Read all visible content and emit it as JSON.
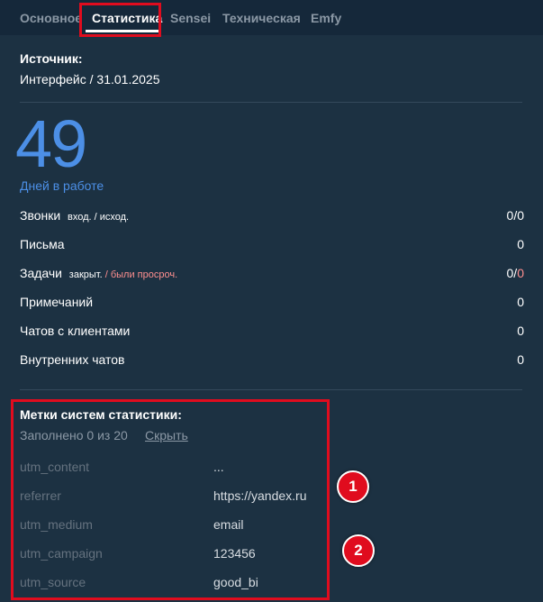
{
  "tabs": [
    {
      "label": "Основное"
    },
    {
      "label": "Статистика",
      "active": true
    },
    {
      "label": "Sensei"
    },
    {
      "label": "Техническая"
    },
    {
      "label": "Emfy"
    }
  ],
  "source": {
    "title": "Источник:",
    "value": "Интерфейс / 31.01.2025"
  },
  "days": {
    "number": "49",
    "label": "Дней в работе"
  },
  "stats": {
    "calls": {
      "label": "Звонки",
      "sub": "вход. / исход.",
      "value": "0/0"
    },
    "letters": {
      "label": "Письма",
      "value": "0"
    },
    "tasks": {
      "label": "Задачи",
      "sub_a": "закрыт.",
      "sub_sep": " / ",
      "sub_b": "были просроч.",
      "value_a": "0/",
      "value_b": "0"
    },
    "notes": {
      "label": "Примечаний",
      "value": "0"
    },
    "client_chats": {
      "label": "Чатов с клиентами",
      "value": "0"
    },
    "internal_chats": {
      "label": "Внутренних чатов",
      "value": "0"
    }
  },
  "utm": {
    "title": "Метки систем статистики:",
    "filled": "Заполнено 0 из 20",
    "hide_label": "Скрыть",
    "rows": [
      {
        "key": "utm_content",
        "value": "..."
      },
      {
        "key": "referrer",
        "value": "https://yandex.ru"
      },
      {
        "key": "utm_medium",
        "value": "email"
      },
      {
        "key": "utm_campaign",
        "value": "123456"
      },
      {
        "key": "utm_source",
        "value": "good_bi"
      }
    ]
  },
  "markers": [
    {
      "label": "1"
    },
    {
      "label": "2"
    }
  ],
  "colors": {
    "accent": "#4c8fe6",
    "highlight": "#e00c1e",
    "overdue": "#ff8f8f",
    "background": "#1c3142"
  }
}
